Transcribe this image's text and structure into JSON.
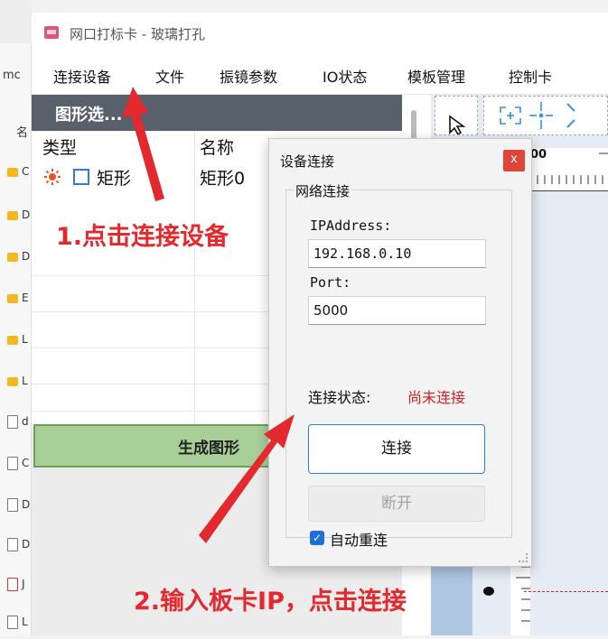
{
  "background": {
    "left_partial_label_top": "mc",
    "left_partial_label_2": "名",
    "folder_letters": [
      "C",
      "D",
      "D",
      "E",
      "L",
      "L"
    ],
    "file_letters": [
      "d",
      "C",
      "D",
      "D",
      "J",
      "L"
    ]
  },
  "window": {
    "title": "网口打标卡 - 玻璃打孔"
  },
  "menubar": {
    "items": [
      "连接设备",
      "文件",
      "振镜参数",
      "IO状态",
      "模板管理",
      "控制卡"
    ]
  },
  "left_panel": {
    "header": "图形选...",
    "columns": [
      "类型",
      "名称"
    ],
    "rows": [
      {
        "type": "矩形",
        "name": "矩形0"
      }
    ],
    "generate_button": "生成图形"
  },
  "ruler": {
    "partial_label": "00"
  },
  "dialog": {
    "title": "设备连接",
    "close_label": "x",
    "group_title": "网络连接",
    "ip_label": "IPAddress:",
    "ip_value": "192.168.0.10",
    "port_label": "Port:",
    "port_value": "5000",
    "status_label": "连接状态:",
    "status_value": "尚未连接",
    "connect_button": "连接",
    "disconnect_button": "断开",
    "auto_reconnect_label": "自动重连",
    "auto_reconnect_checked": true
  },
  "annotations": {
    "step1": "1.点击连接设备",
    "step2": "2.输入板卡IP，点击连接"
  },
  "colors": {
    "annotation_red": "#e3282e",
    "status_red": "#d32222",
    "panel_header": "#57606b",
    "generate_green": "#a7cf97",
    "accent_blue": "#2b7be0",
    "close_red": "#e0453a"
  }
}
